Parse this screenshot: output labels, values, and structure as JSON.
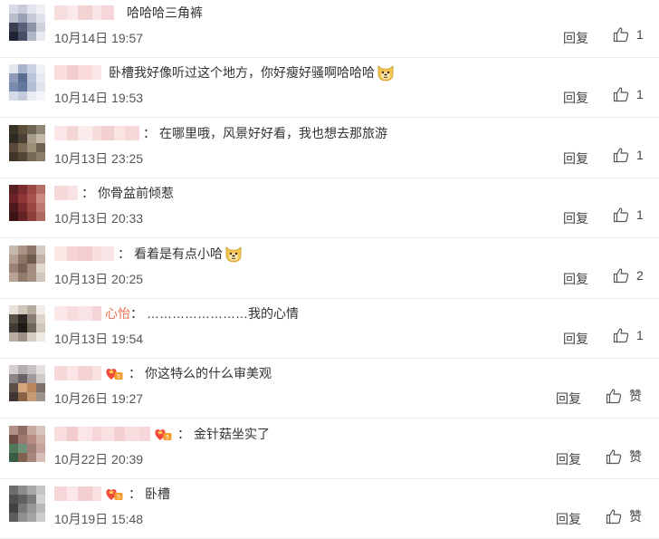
{
  "comments": [
    {
      "name_suffix": "",
      "text": "哈哈哈三角裤",
      "has_badge": false,
      "has_dog": false,
      "date": "10月14日 19:57",
      "reply": "回复",
      "like": "1",
      "avatar": [
        "#d8dbe6",
        "#c9ccd8",
        "#e3e5ee",
        "#eef0f4",
        "#b8bdcc",
        "#9aa0b3",
        "#c6cad6",
        "#dfe2ea",
        "#3a3f52",
        "#596077",
        "#8d93a6",
        "#cfd2dc",
        "#1f2333",
        "#474d62",
        "#b1b6c4",
        "#e9ebf0"
      ],
      "name": [
        "#f7dede",
        "#fbe9e9",
        "#f3d2d4",
        "#fae4e5",
        "#f6d6d8"
      ]
    },
    {
      "name_suffix": "",
      "text": "卧槽我好像听过这个地方，你好瘦好骚啊哈哈哈",
      "has_badge": false,
      "has_dog": true,
      "date": "10月14日 19:53",
      "reply": "回复",
      "like": "1",
      "avatar": [
        "#e4e7ee",
        "#a8b4cc",
        "#c9d2e2",
        "#eef1f6",
        "#8d9bb8",
        "#5a6d93",
        "#b9c5d9",
        "#e6eaf1",
        "#7a8bad",
        "#6579a0",
        "#b0bdd3",
        "#dfe4ec",
        "#d5dbe6",
        "#c4ccdc",
        "#e9edf3",
        "#f3f5f8"
      ],
      "name": [
        "#fadede",
        "#f3cccf",
        "#f8dadb",
        "#fbe6e7"
      ]
    },
    {
      "name_suffix": "",
      "text": "在哪里哦，风景好好看，我也想去那旅游",
      "has_badge": false,
      "has_dog": false,
      "date": "10月13日 23:25",
      "reply": "回复",
      "like": "1",
      "avatar": [
        "#3b3226",
        "#5c4d3b",
        "#6d6452",
        "#8f8673",
        "#2f2a21",
        "#4a4033",
        "#a59d8a",
        "#c1b9a6",
        "#58493a",
        "#7b6a55",
        "#9b8f78",
        "#6e6350",
        "#3f3629",
        "#524636",
        "#766a55",
        "#8a7e68"
      ],
      "name": [
        "#fae6e6",
        "#f5d6d8",
        "#fbebeb",
        "#f7dcdd",
        "#f2d0d2",
        "#fae4e4",
        "#f6d8da"
      ]
    },
    {
      "name_suffix": "",
      "text": "你骨盆前倾惹",
      "has_badge": false,
      "has_dog": false,
      "date": "10月13日 20:33",
      "reply": "回复",
      "like": "1",
      "avatar": [
        "#5a1f22",
        "#7a2c2f",
        "#9c4a45",
        "#b56e66",
        "#6b2125",
        "#8f3537",
        "#a8524c",
        "#c98b80",
        "#4d1a1c",
        "#772a2d",
        "#9a4641",
        "#bd7a70",
        "#3c1416",
        "#652326",
        "#8c3d3a",
        "#b06960"
      ],
      "name": [
        "#f5d8da",
        "#f9e2e3"
      ]
    },
    {
      "name_suffix": "",
      "text": "看着是有点小哈",
      "has_badge": false,
      "has_dog": true,
      "date": "10月13日 20:25",
      "reply": "回复",
      "like": "2",
      "avatar": [
        "#c7b8ad",
        "#a99588",
        "#8c766a",
        "#d6cbc2",
        "#b49f91",
        "#8e7667",
        "#6f5a4e",
        "#c2b2a6",
        "#9b8275",
        "#7b6257",
        "#a38b7d",
        "#e1d8d0",
        "#b7a497",
        "#927a6d",
        "#a58f82",
        "#d2c6bc"
      ],
      "name": [
        "#fbe5e5",
        "#f6d4d6",
        "#f3cfd1",
        "#f9dfe0",
        "#fae5e6"
      ]
    },
    {
      "name_suffix": "心怡",
      "text": "……………………我的心情",
      "has_badge": false,
      "has_dog": false,
      "date": "10月13日 19:54",
      "reply": "回复",
      "like": "1",
      "avatar": [
        "#e8e2da",
        "#cfc5b9",
        "#b7ab9e",
        "#f1ece6",
        "#5b5249",
        "#2e2925",
        "#8a7f73",
        "#ddd5cb",
        "#423b35",
        "#1d1a18",
        "#6e645a",
        "#cfc6bb",
        "#b8ada1",
        "#9d9184",
        "#d6cdc2",
        "#efe9e3"
      ],
      "name": [
        "#fbe9ea",
        "#f7dcdd",
        "#f9e3e4",
        "#f4d4d6"
      ]
    },
    {
      "name_suffix": "",
      "text": "你这特么的什么审美观",
      "has_badge": true,
      "has_dog": false,
      "date": "10月26日 19:27",
      "reply": "回复",
      "like": "赞",
      "avatar": [
        "#d5d0cf",
        "#b4aeb0",
        "#c7c1c1",
        "#e4e0df",
        "#8d8488",
        "#6b6166",
        "#a2999b",
        "#cfc9c8",
        "#5c4f4a",
        "#d5a67b",
        "#b9855c",
        "#7d6f6a",
        "#3f3534",
        "#8a6447",
        "#c69a74",
        "#9e928f"
      ],
      "name": [
        "#f8d9db",
        "#fbe5e6",
        "#f5d2d4",
        "#f9e0e1"
      ]
    },
    {
      "name_suffix": "",
      "text": "金针菇坐实了",
      "has_badge": true,
      "has_dog": false,
      "date": "10月22日 20:39",
      "reply": "回复",
      "like": "赞",
      "avatar": [
        "#b08f86",
        "#8f6b62",
        "#c7a8a0",
        "#d9c3bd",
        "#6f4c45",
        "#9e776e",
        "#b78c82",
        "#cfb0a8",
        "#4f7a5a",
        "#6d9278",
        "#a07f76",
        "#c3a39b",
        "#385c43",
        "#82624f",
        "#a9867c",
        "#d8bdb6"
      ],
      "name": [
        "#f9dcdd",
        "#f3cbcd",
        "#fbe5e6",
        "#f6d6d8",
        "#fae1e2",
        "#f4d0d2",
        "#f9dedf",
        "#f7d8da"
      ]
    },
    {
      "name_suffix": "",
      "text": "卧槽",
      "has_badge": true,
      "has_dog": false,
      "date": "10月19日 15:48",
      "reply": "回复",
      "like": "赞",
      "avatar": [
        "#6b6e6b",
        "#8a8d8a",
        "#a8aaa8",
        "#c4c6c4",
        "#4e514e",
        "#5f625f",
        "#7b7e7b",
        "#d1d3d1",
        "#3f423f",
        "#777a77",
        "#969996",
        "#b7b9b7",
        "#5a5d5a",
        "#8d908d",
        "#a2a5a2",
        "#cbcdcb"
      ],
      "name": [
        "#f6d6d8",
        "#fbe7e8",
        "#f4cfd1",
        "#f9e0e1"
      ]
    }
  ],
  "colors": {
    "text": "#333333",
    "meta": "#555555",
    "name_suffix": "#eb7350",
    "divider": "#ececec"
  },
  "icons": {
    "like": "thumbs-up-icon",
    "badge": "vip-heart-badge-icon",
    "emoji": "doge-emoji-icon"
  }
}
